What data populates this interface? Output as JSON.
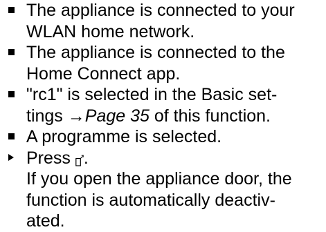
{
  "heading": "",
  "requirements": [
    {
      "lines": [
        "The appliance is connected to your",
        "WLAN home network."
      ]
    },
    {
      "lines": [
        "The appliance is connected to the",
        "Home Connect app."
      ]
    },
    {
      "line1": "\"rc1\" is selected in the Basic set-",
      "line2_prefix": "tings ",
      "arrow": "→",
      "page_ref": "Page 35",
      "line2_suffix": " of this function."
    },
    {
      "lines": [
        "A programme is selected."
      ]
    }
  ],
  "action": {
    "press_text": "Press ",
    "press_suffix": ".",
    "icon": "remote-start-icon",
    "result_lines": [
      "If you open the appliance door, the",
      "function is automatically deactiv-",
      "ated."
    ]
  }
}
